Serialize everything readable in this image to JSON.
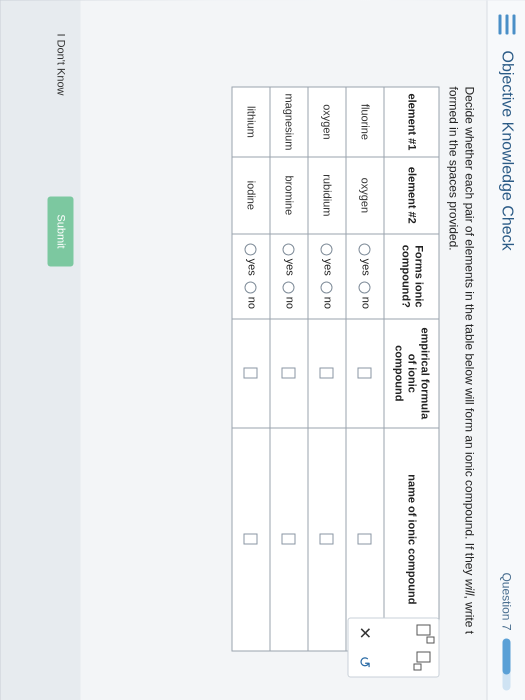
{
  "header": {
    "title": "Objective Knowledge Check",
    "question_label": "Question 7",
    "progress_fraction": 0.7
  },
  "instructions": {
    "text_before_italic": "Decide whether each pair of elements in the table below will form an ionic compound. If they ",
    "italic_text": "will",
    "text_after_italic": ", write t",
    "line2": "formed in the spaces provided."
  },
  "table": {
    "headers": [
      "element #1",
      "element #2",
      "Forms ionic compound?",
      "empirical formula of ionic compound",
      "name of ionic compound"
    ],
    "yes_label": "yes",
    "no_label": "no",
    "rows": [
      {
        "element1": "fluorine",
        "element2": "oxygen"
      },
      {
        "element1": "oxygen",
        "element2": "rubidium"
      },
      {
        "element1": "magnesium",
        "element2": "bromine"
      },
      {
        "element1": "lithium",
        "element2": "iodine"
      }
    ]
  },
  "tools": {
    "superscript_icon": "superscript-box-icon",
    "subscript_icon": "subscript-box-icon",
    "clear_symbol": "✕",
    "undo_symbol": "↺"
  },
  "footer": {
    "dont_know_label": "I Don't Know",
    "submit_label": "Submit"
  },
  "colors": {
    "accent": "#2b5b86",
    "menu": "#4a8fc7",
    "submit": "#7cc8a0"
  }
}
